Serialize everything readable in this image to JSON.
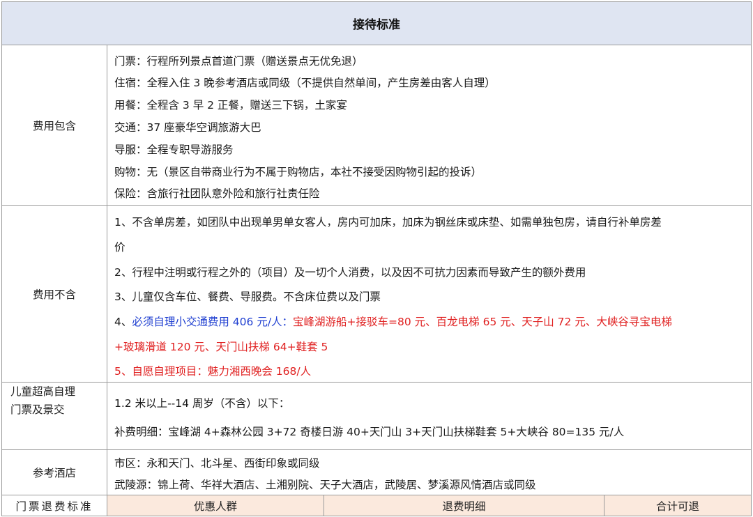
{
  "title": "接待标准",
  "included": {
    "label": "费用包含",
    "items": [
      "门票：行程所列景点首道门票（赠送景点无优免退）",
      "住宿：全程入住 3 晚参考酒店或同级（不提供自然单间，产生房差由客人自理）",
      "用餐：全程含 3 早 2 正餐，赠送三下锅，土家宴",
      "交通：37 座豪华空调旅游大巴",
      "导服：全程专职导游服务",
      "购物：无（景区自带商业行为不属于购物店，本社不接受因购物引起的投诉）",
      "保险：含旅行社团队意外险和旅行社责任险"
    ]
  },
  "excluded": {
    "label": "费用不含",
    "item1_line1": "1、不含单房差，如团队中出现单男单女客人，房内可加床，加床为钢丝床或床垫、如需单独包房，请自行补单房差",
    "item1_line2": "价",
    "item2": "2、行程中注明或行程之外的（项目）及一切个人消费，以及因不可抗力因素而导致产生的额外费用",
    "item3": "3、儿童仅含车位、餐费、导服费。不含床位费以及门票",
    "item4_prefix": "4、",
    "item4_blue": "必须自理小交通费用 406 元/人：",
    "item4_red_line1": "宝峰湖游船+接驳车=80 元、百龙电梯 65 元、天子山 72 元、大峡谷寻宝电梯",
    "item4_red_line2": "+玻璃滑道 120 元、天门山扶梯 64+鞋套 5",
    "item5_prefix": "5、",
    "item5_red": "自愿自理项目：魅力湘西晚会 168/人"
  },
  "child": {
    "label_line1": "儿童超高自理",
    "label_line2": "门票及景交",
    "line1": "1.2 米以上--14 周岁（不含）以下：",
    "line2": "补费明细：宝峰湖 4+森林公园 3+72 奇楼日游 40+天门山 3+天门山扶梯鞋套 5+大峡谷 80=135 元/人"
  },
  "hotel": {
    "label": "参考酒店",
    "line1": "市区：永和天门、北斗星、西街印象或同级",
    "line2": "武陵源：锦上荷、华祥大酒店、土湘别院、天子大酒店，武陵居、梦溪源风情酒店或同级"
  },
  "refund": {
    "label": "门票退费标准",
    "col1": "优惠人群",
    "col2": "退费明细",
    "col3": "合计可退"
  },
  "colors": {
    "title_bg": "#dfe5f2",
    "header_bg": "#fbe9dd",
    "blue_text": "#1f3fd1",
    "red_text": "#e02020",
    "border": "#9a9a9a"
  }
}
